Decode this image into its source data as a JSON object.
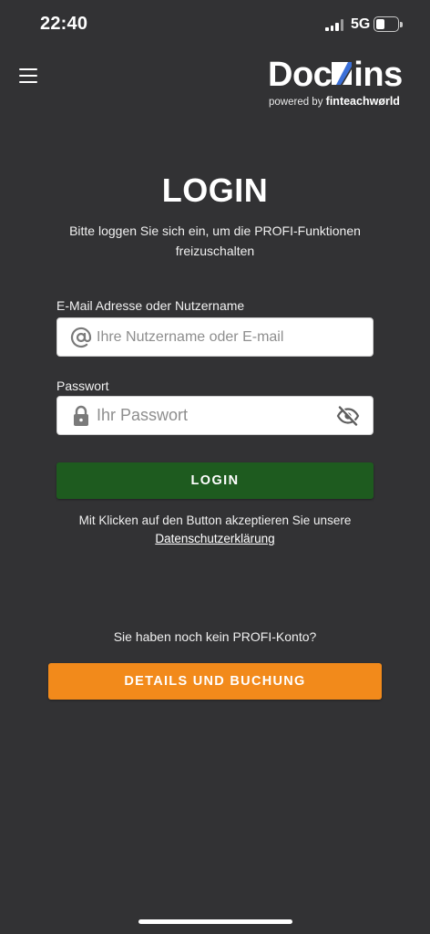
{
  "status_bar": {
    "time": "22:40",
    "network": "5G",
    "battery_level": 0.4
  },
  "header": {
    "logo": {
      "text_pre": "Doc",
      "text_post": "ins",
      "tagline_prefix": "powered by",
      "tagline_brand": "finteachwørld",
      "accent_color": "#3a6fd8"
    }
  },
  "login": {
    "title": "LOGIN",
    "subtitle": "Bitte loggen Sie sich ein, um die PROFI-Funktionen freizuschalten",
    "username_label": "E-Mail Adresse oder Nutzername",
    "username_placeholder": "Ihre Nutzername oder E-mail",
    "password_label": "Passwort",
    "password_placeholder": "Ihr Passwort",
    "submit_label": "LOGIN",
    "consent_text": "Mit Klicken auf den Button akzeptieren Sie unsere",
    "privacy_link": "Datenschutzerklärung"
  },
  "signup": {
    "prompt": "Sie haben noch kein PROFI-Konto?",
    "button_label": "DETAILS UND BUCHUNG"
  },
  "colors": {
    "background": "#323234",
    "login_button": "#1e5b1f",
    "details_button": "#f28a1b"
  },
  "icons": [
    "menu-icon",
    "at-sign-icon",
    "lock-icon",
    "eye-off-icon"
  ]
}
